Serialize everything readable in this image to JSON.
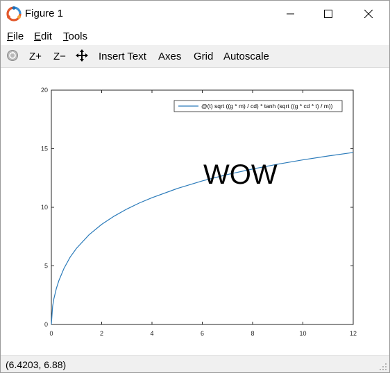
{
  "window": {
    "title": "Figure 1"
  },
  "menu": {
    "items": [
      {
        "first": "F",
        "rest": "ile"
      },
      {
        "first": "E",
        "rest": "dit"
      },
      {
        "first": "T",
        "rest": "ools"
      }
    ]
  },
  "toolbar": {
    "zoom_in": "Z+",
    "zoom_out": "Z−",
    "insert_text": "Insert Text",
    "axes": "Axes",
    "grid": "Grid",
    "autoscale": "Autoscale"
  },
  "colors": {
    "line": "#2b7bba",
    "toolbar_bg": "#f0f0f0"
  },
  "chart_data": {
    "type": "line",
    "title": "",
    "xlabel": "",
    "ylabel": "",
    "xlim": [
      0,
      12
    ],
    "ylim": [
      0,
      20
    ],
    "xticks": [
      0,
      2,
      4,
      6,
      8,
      10,
      12
    ],
    "yticks": [
      0,
      5,
      10,
      15,
      20
    ],
    "grid": false,
    "legend_position": "top-right",
    "annotation": "WOW",
    "series": [
      {
        "name": "@(t) sqrt ((g * m) / cd) * tanh (sqrt ((g * cd * t) / m))",
        "x": [
          0,
          0.05,
          0.1,
          0.2,
          0.3,
          0.5,
          0.75,
          1,
          1.5,
          2,
          2.5,
          3,
          3.5,
          4,
          5,
          6,
          7,
          8,
          9,
          10,
          11,
          12
        ],
        "y": [
          0,
          1.55,
          2.19,
          3.08,
          3.75,
          4.78,
          5.76,
          6.5,
          7.66,
          8.54,
          9.25,
          9.85,
          10.37,
          10.82,
          11.6,
          12.25,
          12.8,
          13.27,
          13.68,
          14.05,
          14.38,
          14.68
        ]
      }
    ]
  },
  "status": {
    "coords": "(6.4203, 6.88)"
  }
}
